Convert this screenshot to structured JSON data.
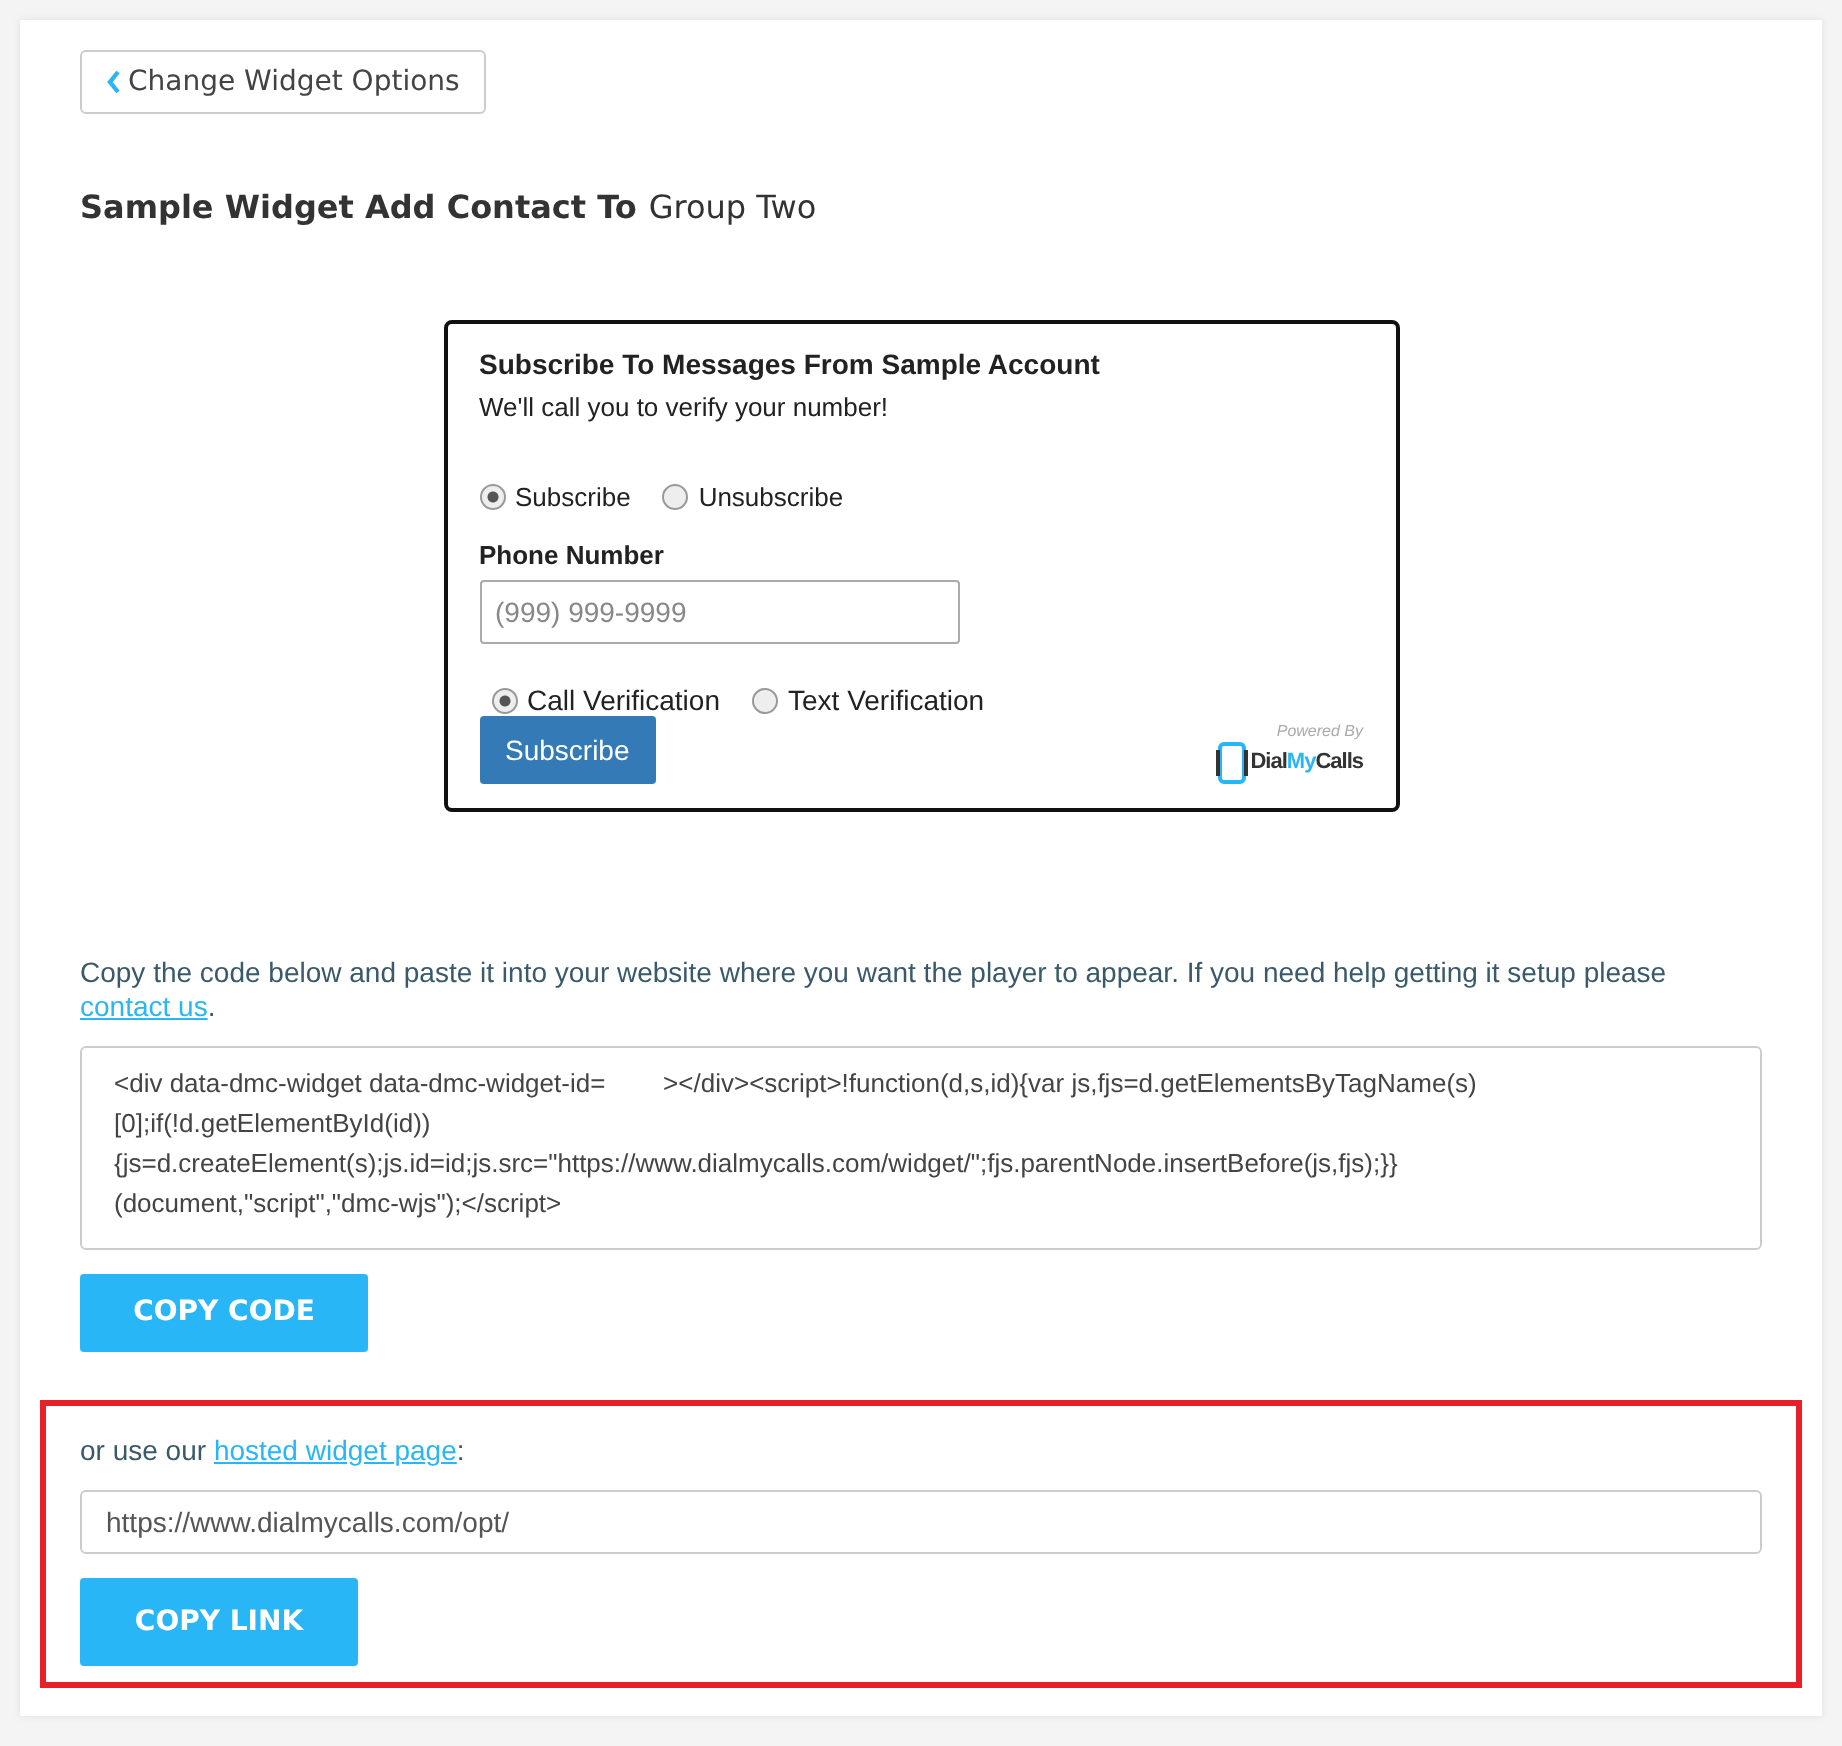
{
  "back_button": {
    "label": "Change Widget Options"
  },
  "heading": {
    "prefix": "Sample Widget Add Contact To",
    "group": "Group Two"
  },
  "widget": {
    "title": "Subscribe To Messages From Sample Account",
    "subtitle": "We'll call you to verify your number!",
    "actions": [
      {
        "label": "Subscribe",
        "selected": true
      },
      {
        "label": "Unsubscribe",
        "selected": false
      }
    ],
    "phone_label": "Phone Number",
    "phone_placeholder": "(999) 999-9999",
    "verification": [
      {
        "label": "Call Verification",
        "selected": true
      },
      {
        "label": "Text Verification",
        "selected": false
      }
    ],
    "submit": "Subscribe",
    "powered_by": "Powered By",
    "brand_a": "Dial",
    "brand_b": "My",
    "brand_c": "Calls"
  },
  "code_section": {
    "intro": "Copy the code below and paste it into your website where you want the player to appear. If you need help getting it setup please ",
    "link": "contact us",
    "after": ".",
    "code_lines": [
      "<div data-dmc-widget data-dmc-widget-id=        ></div><script>!function(d,s,id){var js,fjs=d.getElementsByTagName(s)",
      "[0];if(!d.getElementById(id))",
      "{js=d.createElement(s);js.id=id;js.src=\"https://www.dialmycalls.com/widget/\";fjs.parentNode.insertBefore(js,fjs);}}",
      "(document,\"script\",\"dmc-wjs\");</script>"
    ],
    "button": "COPY CODE"
  },
  "hosted_section": {
    "highlighted": true,
    "intro": "or use our ",
    "link": "hosted widget page",
    "after": ":",
    "url": "https://www.dialmycalls.com/opt/",
    "button": "COPY LINK"
  }
}
